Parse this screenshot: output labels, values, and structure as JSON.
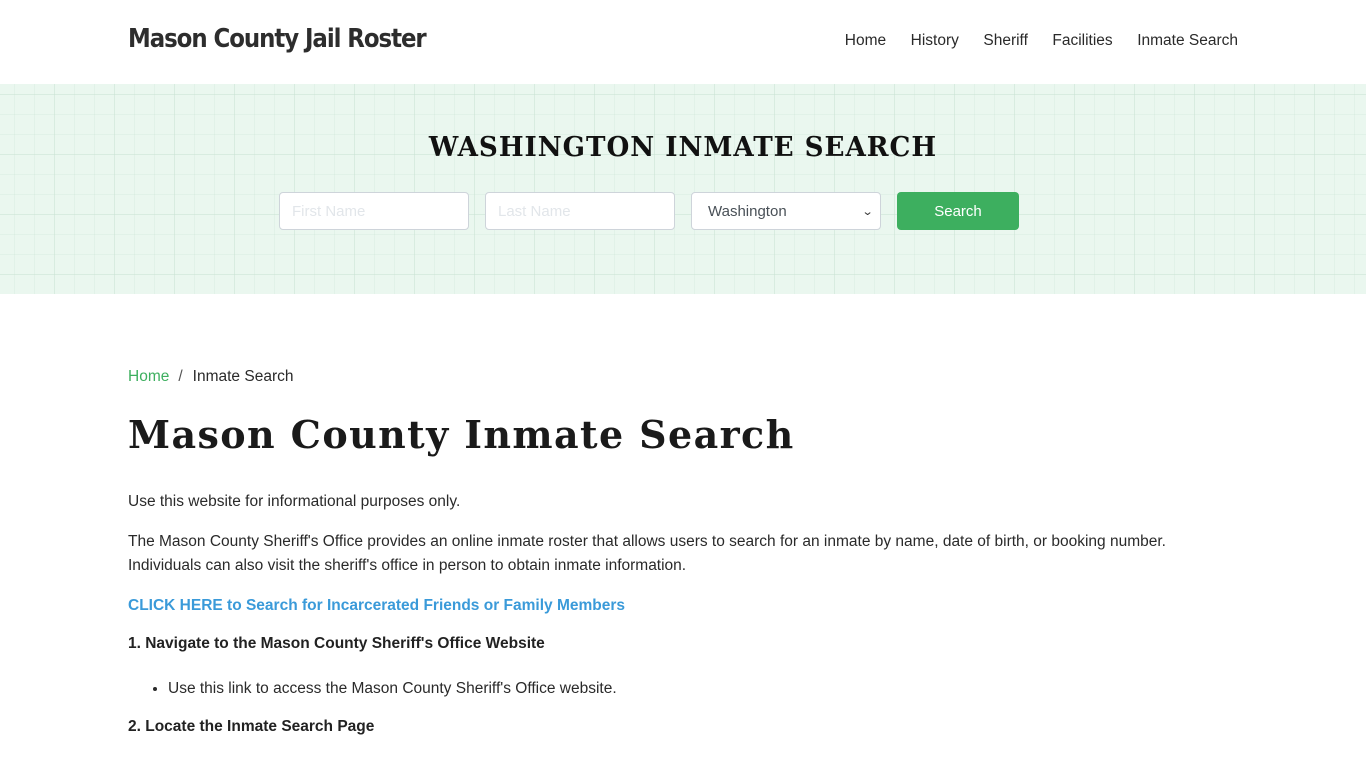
{
  "header": {
    "brand": "Mason County Jail Roster",
    "nav": [
      {
        "label": "Home"
      },
      {
        "label": "History"
      },
      {
        "label": "Sheriff"
      },
      {
        "label": "Facilities"
      },
      {
        "label": "Inmate Search"
      }
    ]
  },
  "hero": {
    "title": "WASHINGTON INMATE SEARCH",
    "first_name_placeholder": "First Name",
    "last_name_placeholder": "Last Name",
    "state_selected": "Washington",
    "search_label": "Search",
    "colors": {
      "accent": "#3daf5f",
      "hero_bg": "#eaf7ef"
    }
  },
  "breadcrumb": {
    "home": "Home",
    "separator": "/",
    "current": "Inmate Search"
  },
  "main": {
    "title": "Mason County Inmate Search",
    "p1": "Use this website for informational purposes only.",
    "p2": "The Mason County Sheriff's Office provides an online inmate roster that allows users to search for an inmate by name, date of birth, or booking number. Individuals can also visit the sheriff's office in person to obtain inmate information.",
    "cta": "CLICK HERE to Search for Incarcerated Friends or Family Members",
    "step1": "1. Navigate to the Mason County Sheriff's Office Website",
    "step1_bullets": [
      "Use this link to access the Mason County Sheriff's Office website."
    ],
    "step2": "2. Locate the Inmate Search Page",
    "link_color": "#3a9ad9"
  }
}
